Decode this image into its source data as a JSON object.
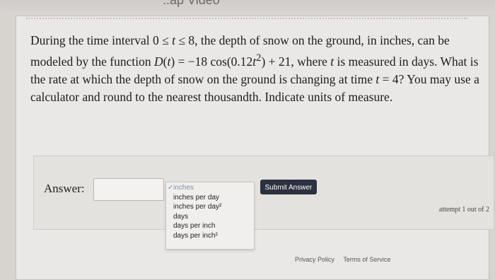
{
  "header": {
    "cut_text": "..ap Video"
  },
  "question": {
    "text_html": "During the time interval 0 ≤ <i>t</i> ≤ 8, the depth of snow on the ground, in inches, can be modeled by the function <i>D</i>(<i>t</i>) = −18 cos(0.12<i>t</i><sup>2</sup>) + 21, where <i>t</i> is measured in days. What is the rate at which the depth of snow on the ground is changing at time <i>t</i> = 4? You may use a calculator and round to the nearest thousandth. Indicate units of measure."
  },
  "answer": {
    "label": "Answer:",
    "value": "",
    "units": {
      "options": [
        "inches",
        "inches per day",
        "inches per day²",
        "days",
        "days per inch",
        "days per inch²"
      ],
      "selected_index": 0
    },
    "submit_label": "Submit Answer",
    "attempt_text": "attempt 1 out of 2"
  },
  "footer": {
    "privacy": "Privacy Policy",
    "terms": "Terms of Service"
  },
  "colors": {
    "button_bg": "#2b3140",
    "card_bg": "#eae8e6",
    "page_bg": "#d7d3cf"
  }
}
